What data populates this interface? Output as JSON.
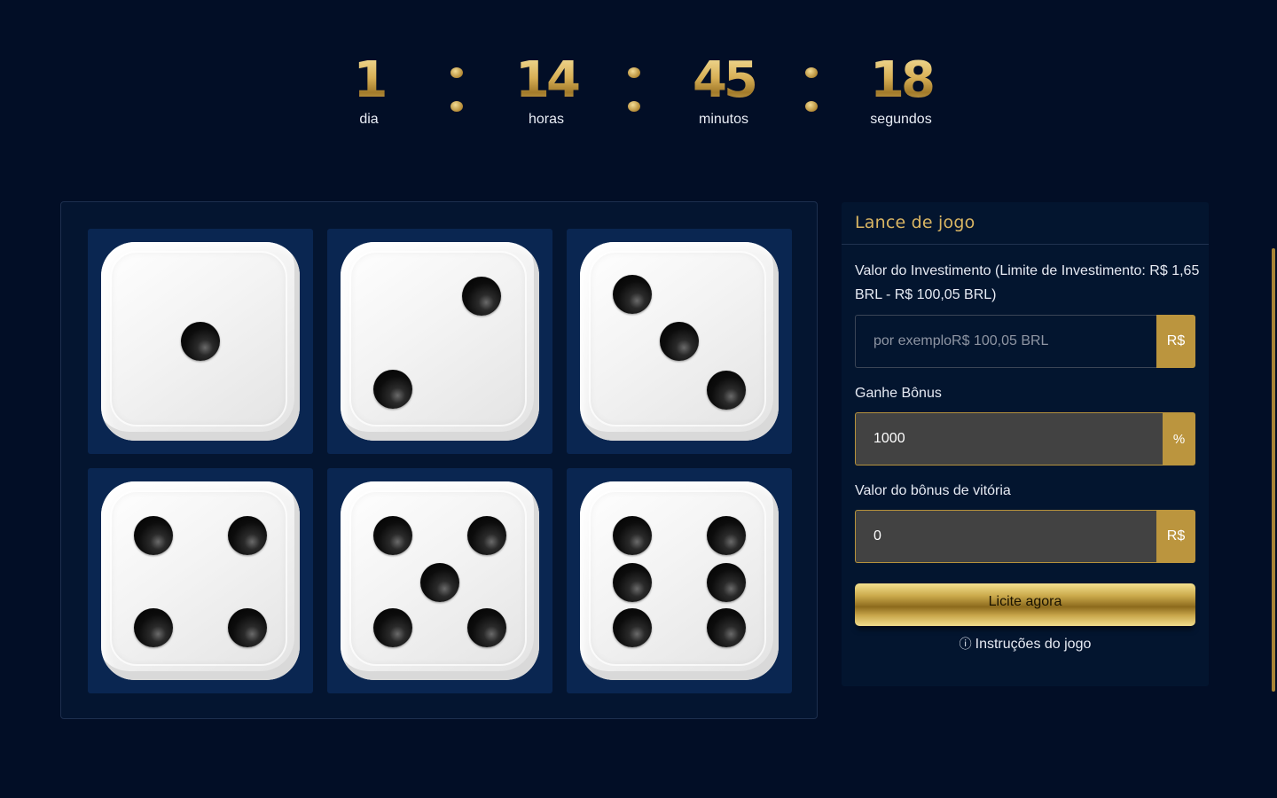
{
  "countdown": {
    "units": [
      {
        "value": "1",
        "label": "dia"
      },
      {
        "value": "14",
        "label": "horas"
      },
      {
        "value": "45",
        "label": "minutos"
      },
      {
        "value": "18",
        "label": "segundos"
      }
    ]
  },
  "dice": [
    1,
    2,
    3,
    4,
    5,
    6
  ],
  "panel": {
    "title": "Lance de jogo",
    "investment": {
      "label": "Valor do Investimento (Limite de Investimento: R$ 1,65 BRL - R$ 100,05 BRL)",
      "placeholder": "por exemploR$ 100,05 BRL",
      "addon": "R$"
    },
    "bonus": {
      "label": "Ganhe Bônus",
      "value": "1000",
      "addon": "%"
    },
    "win_bonus": {
      "label": "Valor do bônus de vitória",
      "value": "0",
      "addon": "R$"
    },
    "bid_button": "Licite agora",
    "instructions_icon": "ⓘ",
    "instructions": "Instruções do jogo"
  },
  "colors": {
    "background": "#020e26",
    "gold": "#bb953e",
    "cell": "#0a2651"
  }
}
